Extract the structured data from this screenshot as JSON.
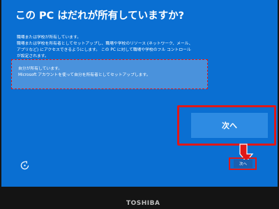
{
  "title": "この PC はだれが所有していますか?",
  "option_org": {
    "title": "職場または学校が所有しています。",
    "desc_lines": [
      "職場または学校を所有者としてセットアップし、職場や学校のリソース (ネットワーク、メール、",
      "アプリなど) にアクセスできるようにします。 この PC に対して職場や学校のフル コントロール",
      "が設定されます。"
    ]
  },
  "option_personal": {
    "title": "自分が所有しています。",
    "desc": "Microsoft アカウントを使って自分を所有者としてセットアップします。"
  },
  "next_button_zoom_label": "次へ",
  "next_button_label": "次へ",
  "accessibility_icon": "accessibility-icon",
  "bezel_brand": "TOSHIBA",
  "colors": {
    "screen": "#0a6fd2",
    "highlight": "#e01818",
    "option_selected": "#4a92dc"
  }
}
